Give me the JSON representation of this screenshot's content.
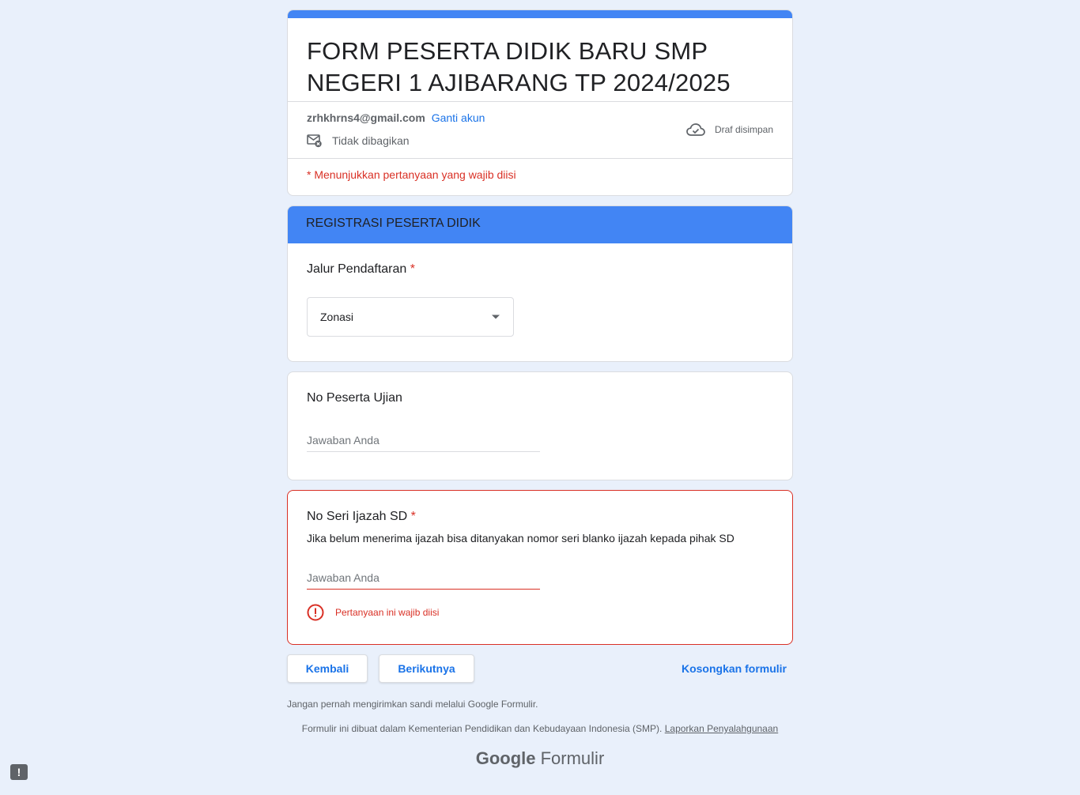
{
  "header": {
    "title": "FORM PESERTA DIDIK BARU SMP NEGERI 1 AJIBARANG TP 2024/2025",
    "email": "zrhkhrns4@gmail.com",
    "switch_account": "Ganti akun",
    "not_shared": "Tidak dibagikan",
    "draft_status": "Draf disimpan",
    "required_note": "* Menunjukkan pertanyaan yang wajib diisi"
  },
  "section": {
    "title": "REGISTRASI PESERTA DIDIK",
    "q1": {
      "label": "Jalur Pendaftaran",
      "required_mark": "*",
      "selected": "Zonasi"
    }
  },
  "q2": {
    "label": "No Peserta Ujian",
    "placeholder": "Jawaban Anda"
  },
  "q3": {
    "label": "No Seri Ijazah SD",
    "required_mark": "*",
    "description": "Jika belum menerima ijazah bisa ditanyakan nomor seri blanko ijazah kepada pihak SD",
    "placeholder": "Jawaban Anda",
    "error": "Pertanyaan ini wajib diisi"
  },
  "actions": {
    "back": "Kembali",
    "next": "Berikutnya",
    "clear": "Kosongkan formulir"
  },
  "footer": {
    "warning": "Jangan pernah mengirimkan sandi melalui Google Formulir.",
    "made_in": "Formulir ini dibuat dalam Kementerian Pendidikan dan Kebudayaan Indonesia (SMP).",
    "report": "Laporkan Penyalahgunaan",
    "brand_google": "Google",
    "brand_product": "Formulir"
  },
  "report_fab": "!",
  "colors": {
    "accent": "#4285f4",
    "link": "#1a73e8",
    "error": "#d93025",
    "background": "#e9f0fb"
  },
  "icons": [
    "mail-off-icon",
    "cloud-check-icon",
    "dropdown-arrow-icon",
    "error-icon",
    "feedback-icon"
  ]
}
